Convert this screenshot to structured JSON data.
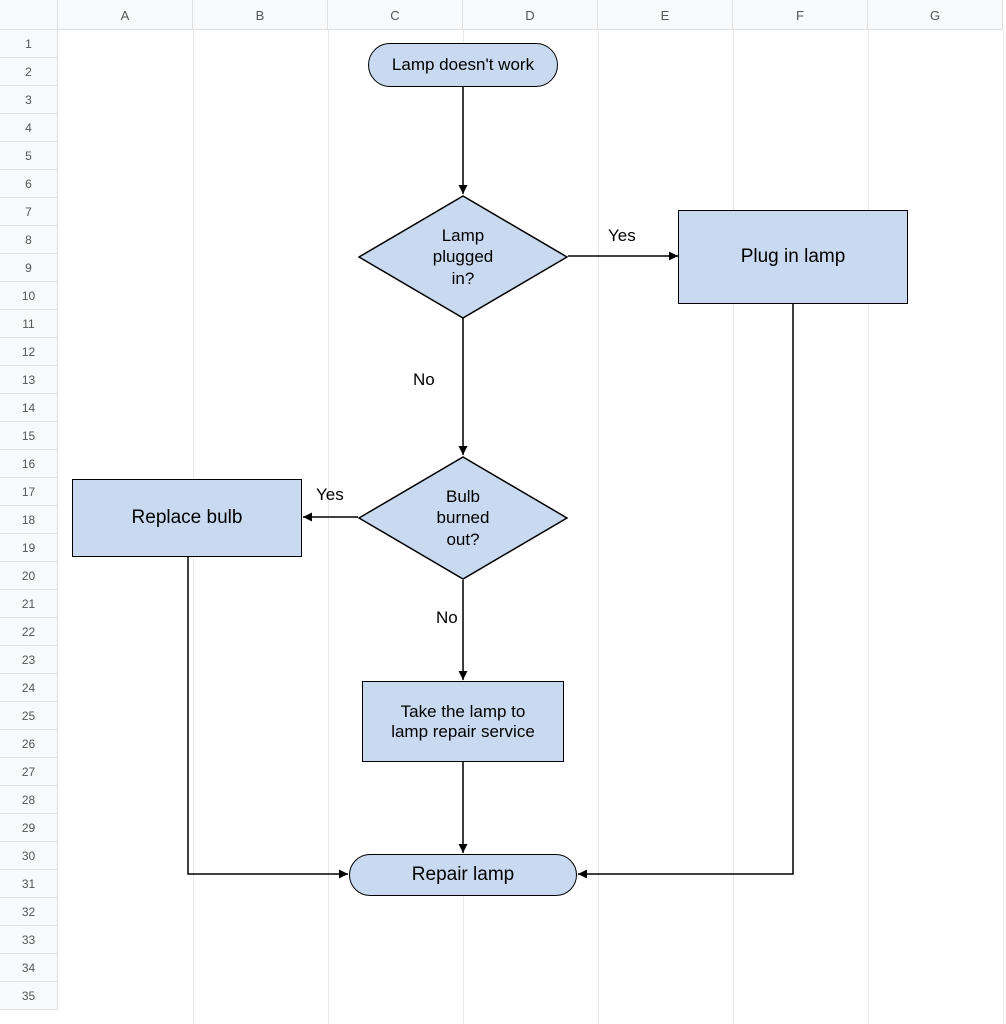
{
  "columns": [
    "A",
    "B",
    "C",
    "D",
    "E",
    "F",
    "G"
  ],
  "rowCount": 35,
  "flow": {
    "start": "Lamp doesn't work",
    "decision1": "Lamp\nplugged\nin?",
    "d1_yes": "Yes",
    "d1_no": "No",
    "process_plug": "Plug in lamp",
    "decision2": "Bulb\nburned\nout?",
    "d2_yes": "Yes",
    "d2_no": "No",
    "process_replace": "Replace bulb",
    "process_take": "Take the lamp to\nlamp repair service",
    "end": "Repair lamp"
  },
  "chart_data": {
    "type": "flowchart",
    "title": "",
    "nodes": [
      {
        "id": "start",
        "type": "terminator",
        "label": "Lamp doesn't work"
      },
      {
        "id": "d1",
        "type": "decision",
        "label": "Lamp plugged in?"
      },
      {
        "id": "plug",
        "type": "process",
        "label": "Plug in lamp"
      },
      {
        "id": "d2",
        "type": "decision",
        "label": "Bulb burned out?"
      },
      {
        "id": "replace",
        "type": "process",
        "label": "Replace bulb"
      },
      {
        "id": "take",
        "type": "process",
        "label": "Take the lamp to lamp repair service"
      },
      {
        "id": "end",
        "type": "terminator",
        "label": "Repair lamp"
      }
    ],
    "edges": [
      {
        "from": "start",
        "to": "d1",
        "label": ""
      },
      {
        "from": "d1",
        "to": "plug",
        "label": "Yes"
      },
      {
        "from": "d1",
        "to": "d2",
        "label": "No"
      },
      {
        "from": "d2",
        "to": "replace",
        "label": "Yes"
      },
      {
        "from": "d2",
        "to": "take",
        "label": "No"
      },
      {
        "from": "take",
        "to": "end",
        "label": ""
      },
      {
        "from": "plug",
        "to": "end",
        "label": ""
      },
      {
        "from": "replace",
        "to": "end",
        "label": ""
      }
    ]
  }
}
